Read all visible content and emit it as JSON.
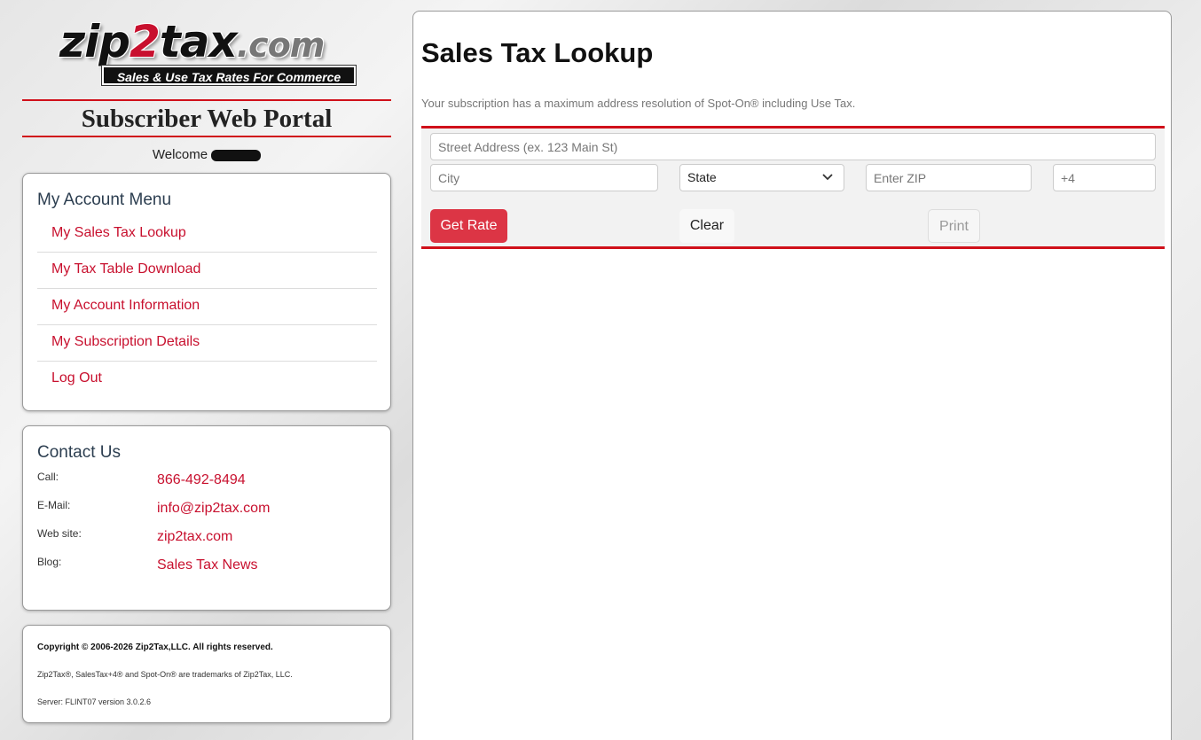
{
  "brand": {
    "logo_main": "zip",
    "logo_two": "2",
    "logo_tax": "tax",
    "logo_dotcom": ".com",
    "tagline": "Sales & Use Tax Rates For Commerce"
  },
  "portal_title": "Subscriber Web Portal",
  "welcome": "Welcome",
  "account_menu": {
    "title": "My Account Menu",
    "items": [
      {
        "label": "My Sales Tax Lookup"
      },
      {
        "label": "My Tax Table Download"
      },
      {
        "label": "My Account Information"
      },
      {
        "label": "My Subscription Details"
      },
      {
        "label": "Log Out"
      }
    ]
  },
  "contact": {
    "title": "Contact Us",
    "rows": [
      {
        "label": "Call:",
        "value": "866-492-8494"
      },
      {
        "label": "E-Mail:",
        "value": "info@zip2tax.com"
      },
      {
        "label": "Web site:",
        "value": "zip2tax.com"
      },
      {
        "label": "Blog:",
        "value": "Sales Tax News"
      }
    ]
  },
  "footer": {
    "copyright": "Copyright © 2006-2026 Zip2Tax,LLC. All rights reserved.",
    "trademarks": "Zip2Tax®, SalesTax+4® and Spot-On® are trademarks of Zip2Tax, LLC.",
    "server": "Server: FLINT07 version 3.0.2.6"
  },
  "lookup": {
    "title": "Sales Tax Lookup",
    "note": "Your subscription has a maximum address resolution of Spot-On® including Use Tax.",
    "street_placeholder": "Street Address (ex. 123 Main St)",
    "city_placeholder": "City",
    "state_selected": "State",
    "zip_placeholder": "Enter ZIP",
    "plus4_placeholder": "+4",
    "get_rate_label": "Get Rate",
    "clear_label": "Clear",
    "print_label": "Print"
  },
  "colors": {
    "accent_red": "#d0101a",
    "link_red": "#c8102e",
    "button_red": "#dc3545"
  }
}
